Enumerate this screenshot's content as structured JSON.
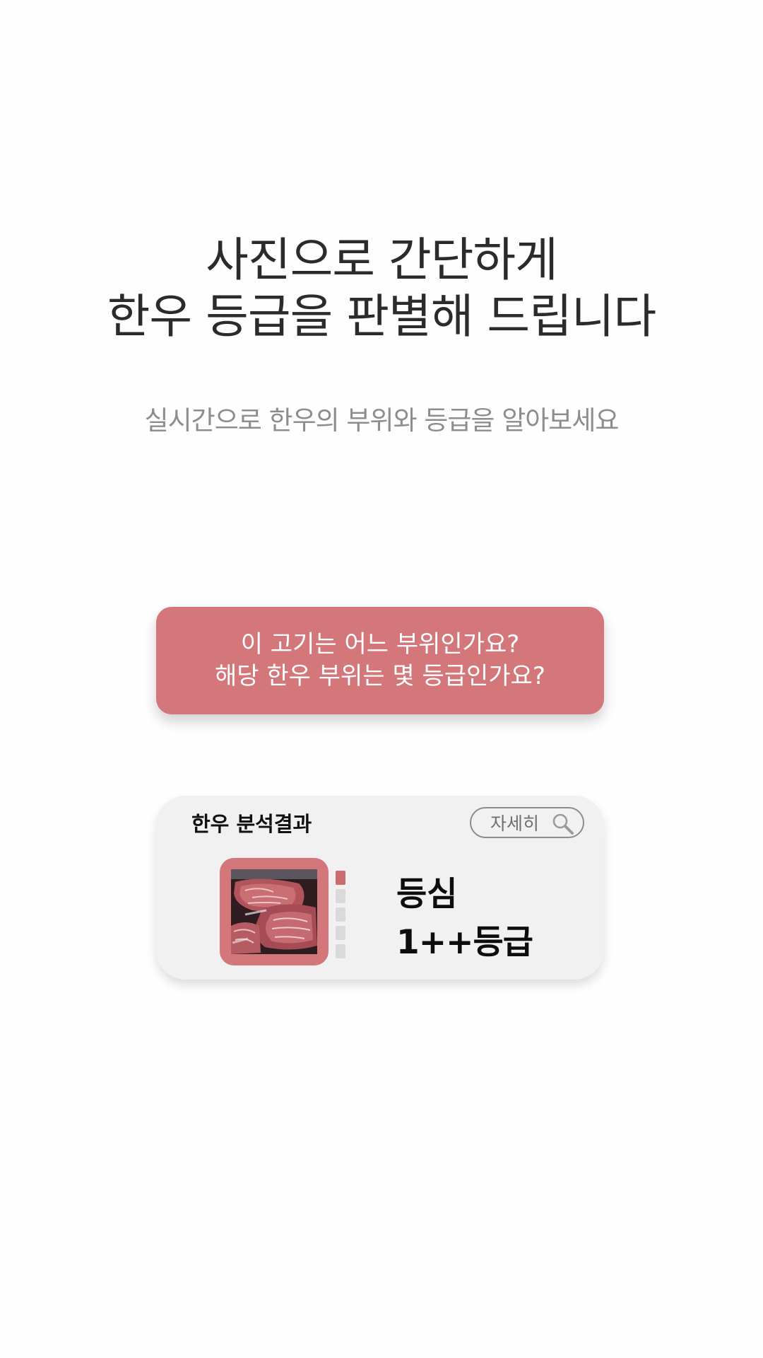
{
  "headline": {
    "line1": "사진으로 간단하게",
    "line2": "한우 등급을 판별해 드립니다"
  },
  "subtitle": "실시간으로 한우의 부위와 등급을 알아보세요",
  "cta": {
    "line1": "이 고기는 어느 부위인가요?",
    "line2": "해당 한우 부위는 몇 등급인가요?"
  },
  "result_card": {
    "title": "한우 분석결과",
    "detail_button": "자세히",
    "part": "등심",
    "grade": "1++등급",
    "thumbnail_icon": "beef-photo",
    "search_icon": "search-icon",
    "grade_level_total": 5,
    "grade_level_active": 1
  },
  "colors": {
    "accent": "#d4777b",
    "card_background": "#f1f1f1",
    "headline_text": "#2b2b2b",
    "subtitle_text": "#8d8d8d"
  }
}
